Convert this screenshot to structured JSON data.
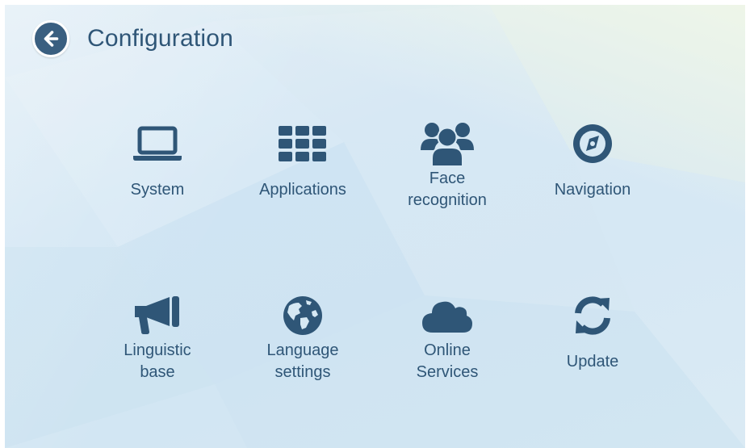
{
  "header": {
    "title": "Configuration",
    "back_icon": "arrow-left-icon"
  },
  "colors": {
    "primary": "#2f5677",
    "back_button": "#3a5f80",
    "background_start": "#e2eef6",
    "background_end": "#d2e6f3"
  },
  "tiles": [
    {
      "icon": "laptop-icon",
      "lines": [
        "System"
      ]
    },
    {
      "icon": "grid-icon",
      "lines": [
        "Applications"
      ]
    },
    {
      "icon": "users-icon",
      "lines": [
        "Face",
        "recognition"
      ]
    },
    {
      "icon": "compass-icon",
      "lines": [
        "Navigation"
      ]
    },
    {
      "icon": "megaphone-icon",
      "lines": [
        "Linguistic",
        "base"
      ]
    },
    {
      "icon": "globe-icon",
      "lines": [
        "Language",
        "settings"
      ]
    },
    {
      "icon": "cloud-icon",
      "lines": [
        "Online",
        "Services"
      ]
    },
    {
      "icon": "refresh-icon",
      "lines": [
        "Update"
      ]
    }
  ]
}
